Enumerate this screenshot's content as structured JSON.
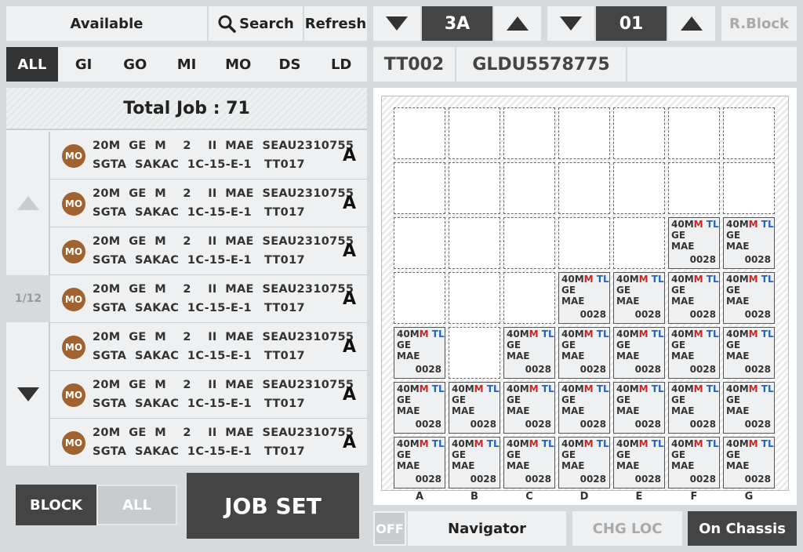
{
  "top": {
    "available_label": "Available",
    "search_label": "Search",
    "refresh_label": "Refresh",
    "bay_value": "3A",
    "tier_value": "01",
    "rblock_label": "R.Block"
  },
  "tabs": [
    "ALL",
    "GI",
    "GO",
    "MI",
    "MO",
    "DS",
    "LD"
  ],
  "active_tab": "ALL",
  "vehicle": {
    "id": "TT002",
    "container": "GLDU5578775",
    "extra": ""
  },
  "jobs": {
    "total_label": "Total Job : 71",
    "page_indicator": "1/12",
    "rows": [
      {
        "badge": "MO",
        "line1": "20M  GE  M    2    II  MAE  SEAU2310755",
        "line2": "SGTA  SAKAC  1C-15-E-1   TT017",
        "grade": "A"
      },
      {
        "badge": "MO",
        "line1": "20M  GE  M    2    II  MAE  SEAU2310755",
        "line2": "SGTA  SAKAC  1C-15-E-1   TT017",
        "grade": "A"
      },
      {
        "badge": "MO",
        "line1": "20M  GE  M    2    II  MAE  SEAU2310755",
        "line2": "SGTA  SAKAC  1C-15-E-1   TT017",
        "grade": "A"
      },
      {
        "badge": "MO",
        "line1": "20M  GE  M    2    II  MAE  SEAU2310755",
        "line2": "SGTA  SAKAC  1C-15-E-1   TT017",
        "grade": "A"
      },
      {
        "badge": "MO",
        "line1": "20M  GE  M    2    II  MAE  SEAU2310755",
        "line2": "SGTA  SAKAC  1C-15-E-1   TT017",
        "grade": "A"
      },
      {
        "badge": "MO",
        "line1": "20M  GE  M    2    II  MAE  SEAU2310755",
        "line2": "SGTA  SAKAC  1C-15-E-1   TT017",
        "grade": "A"
      },
      {
        "badge": "MO",
        "line1": "20M  GE  M    2    II  MAE  SEAU2310755",
        "line2": "SGTA  SAKAC  1C-15-E-1   TT017",
        "grade": "A"
      }
    ]
  },
  "block_toggle": {
    "left": "BLOCK",
    "right": "ALL"
  },
  "jobset_label": "JOB SET",
  "bottom": {
    "off_label": "OFF",
    "navigator_label": "Navigator",
    "chgloc_label": "CHG LOC",
    "onchassis_label": "On Chassis"
  },
  "bay_view": {
    "columns": [
      "A",
      "B",
      "C",
      "D",
      "E",
      "F",
      "G"
    ],
    "tiers": 7,
    "container": {
      "size": "40M",
      "flag": "M",
      "tl": "TL",
      "line2": "GE",
      "line3": "MAE",
      "weight": "0028"
    },
    "occupancy": [
      [
        0,
        0,
        0,
        0,
        0,
        0,
        0
      ],
      [
        0,
        0,
        0,
        0,
        0,
        0,
        0
      ],
      [
        0,
        0,
        0,
        0,
        0,
        1,
        1
      ],
      [
        0,
        0,
        0,
        1,
        1,
        1,
        1
      ],
      [
        1,
        0,
        1,
        1,
        1,
        1,
        1
      ],
      [
        1,
        1,
        1,
        1,
        1,
        1,
        1
      ],
      [
        1,
        1,
        1,
        1,
        1,
        1,
        1
      ]
    ]
  },
  "colors": {
    "badge": "#a0622e",
    "dark": "#444444",
    "active_tab": "#333333",
    "flag_red": "#d32020",
    "tl_blue": "#1f63c4"
  }
}
